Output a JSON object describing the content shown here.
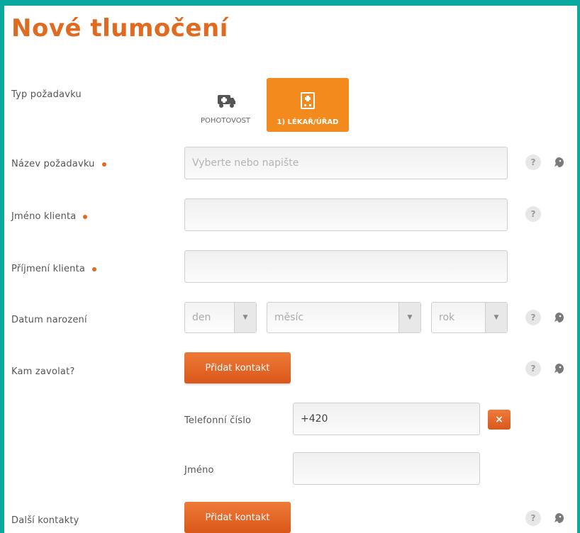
{
  "page": {
    "title": "Nové tlumočení"
  },
  "colors": {
    "accent": "#e06a1f",
    "frame": "#0aa9a0",
    "active_type": "#f28a1d"
  },
  "request_type": {
    "label": "Typ požadavku",
    "options": [
      {
        "label": "POHOTOVOST",
        "icon": "ambulance-icon",
        "selected": false
      },
      {
        "label": "1) LÉKAŘ/ÚŘAD",
        "icon": "clinic-icon",
        "selected": true
      }
    ]
  },
  "request_name": {
    "label": "Název požadavku",
    "placeholder": "Vyberte nebo napište",
    "value": ""
  },
  "client_first_name": {
    "label": "Jméno klienta",
    "value": ""
  },
  "client_last_name": {
    "label": "Příjmení klienta",
    "value": ""
  },
  "birth_date": {
    "label": "Datum narození",
    "day": "den",
    "month": "měsíc",
    "year": "rok"
  },
  "where_to_call": {
    "label": "Kam zavolat?",
    "button": "Přidat kontakt"
  },
  "contact": {
    "phone_label": "Telefonní číslo",
    "phone_value": "+420",
    "remove": "×",
    "name_label": "Jméno",
    "name_value": ""
  },
  "other_contacts": {
    "label": "Další kontakty",
    "button": "Přidat kontakt"
  },
  "help_symbol": "?"
}
